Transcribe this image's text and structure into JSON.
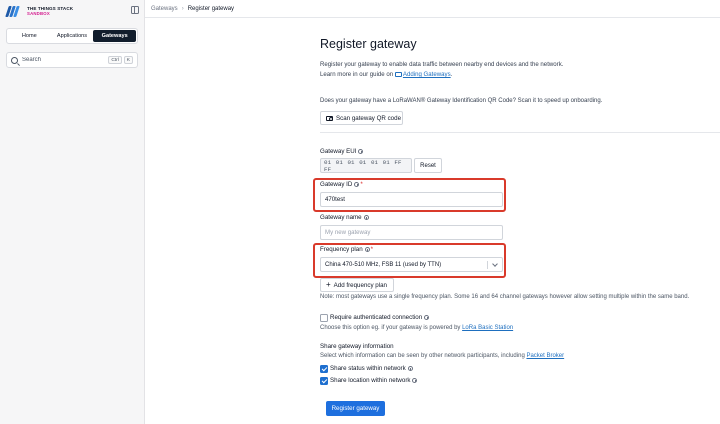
{
  "brand": {
    "line1": "THE THINGS STACK",
    "line2": "SANDBOX"
  },
  "sidebar": {
    "tabs": [
      {
        "label": "Home",
        "active": false
      },
      {
        "label": "Applications",
        "active": false
      },
      {
        "label": "Gateways",
        "active": true
      }
    ],
    "search": {
      "placeholder": "Search",
      "shortcut_1": "Ctrl",
      "shortcut_2": "K"
    }
  },
  "breadcrumb": {
    "parent": "Gateways",
    "current": "Register gateway"
  },
  "page": {
    "title": "Register gateway",
    "description_line1": "Register your gateway to enable data traffic between nearby end devices and the network.",
    "description_line2_prefix": "Learn more in our guide on",
    "guide_link": "Adding Gateways",
    "description_line2_suffix": "."
  },
  "qr": {
    "question": "Does your gateway have a LoRaWAN® Gateway Identification QR Code? Scan it to speed up onboarding.",
    "button_label": "Scan gateway QR code"
  },
  "form": {
    "eui": {
      "label": "Gateway EUI",
      "value": "01 01 01 01 01 01 FF FF",
      "reset_label": "Reset"
    },
    "gateway_id": {
      "label": "Gateway ID",
      "required_mark": "*",
      "value": "470test"
    },
    "gateway_name": {
      "label": "Gateway name",
      "placeholder": "My new gateway",
      "value": ""
    },
    "frequency_plan": {
      "label": "Frequency plan",
      "required_mark": "*",
      "selected": "China 470-510 MHz, FSB 11 (used by TTN)"
    },
    "add_frequency_plan_label": "Add frequency plan",
    "frequency_note": "Note: most gateways use a single frequency plan. Some 16 and 64 channel gateways however allow setting multiple within the same band.",
    "auth": {
      "label": "Require authenticated connection",
      "checked": false,
      "note_prefix": "Choose this option eg. if your gateway is powered by",
      "note_link": "LoRa Basic Station"
    },
    "share": {
      "title": "Share gateway information",
      "note_prefix": "Select which information can be seen by other network participants, including",
      "note_link": "Packet Broker",
      "status_label": "Share status within network",
      "status_checked": true,
      "location_label": "Share location within network",
      "location_checked": true
    },
    "submit_label": "Register gateway"
  },
  "colors": {
    "primary": "#1e6fde",
    "highlight": "#d93a2b",
    "sandbox": "#d4198d",
    "active_tab": "#111d2c"
  }
}
